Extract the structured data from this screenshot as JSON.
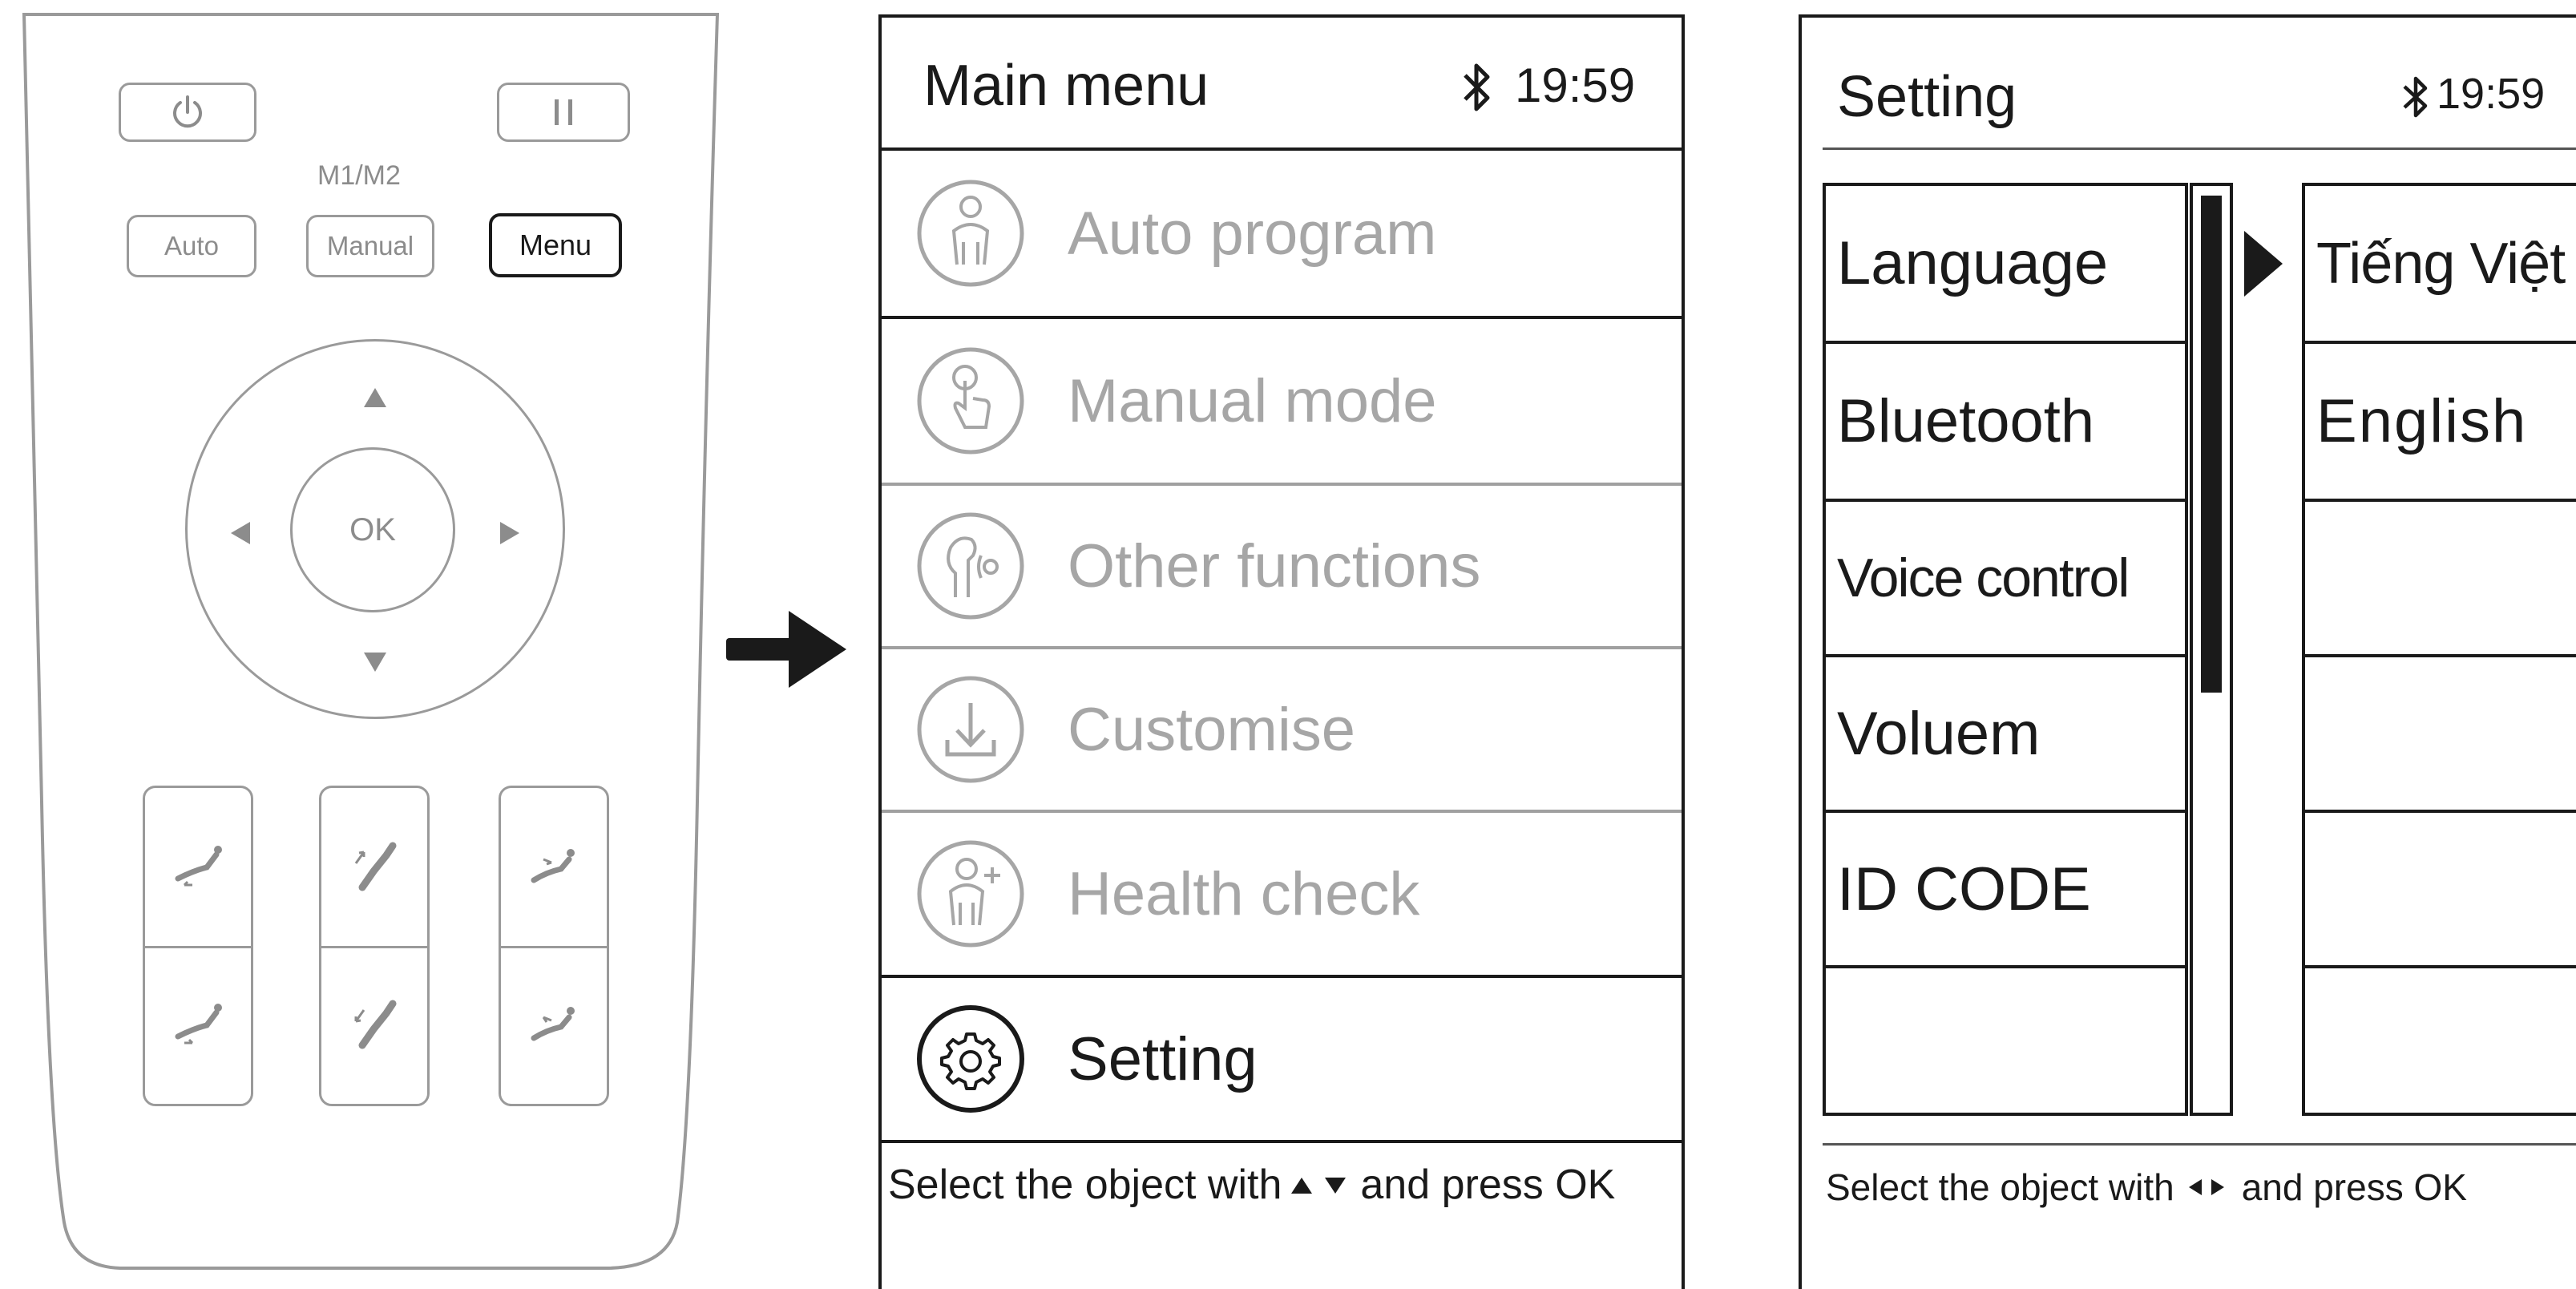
{
  "remote": {
    "power_icon": "power-icon",
    "pause_icon": "pause-icon",
    "m1m2_label": "M1/M2",
    "auto_label": "Auto",
    "manual_label": "Manual",
    "menu_label": "Menu",
    "ok_label": "OK"
  },
  "main_menu": {
    "title": "Main menu",
    "time": "19:59",
    "items": [
      {
        "label": "Auto program",
        "icon": "person-icon"
      },
      {
        "label": "Manual mode",
        "icon": "hand-touch-icon"
      },
      {
        "label": "Other functions",
        "icon": "head-wave-icon"
      },
      {
        "label": "Customise",
        "icon": "download-icon"
      },
      {
        "label": "Health check",
        "icon": "person-plus-icon"
      },
      {
        "label": "Setting",
        "icon": "gear-icon",
        "active": true
      }
    ],
    "footer_prefix": "Select the object with",
    "footer_suffix": "and press OK"
  },
  "settings": {
    "title": "Setting",
    "time": "19:59",
    "items": [
      "Language",
      "Bluetooth",
      "Voice control",
      "Voluem",
      "ID CODE",
      ""
    ],
    "options": [
      "Tiếng Việt",
      "English",
      "",
      "",
      "",
      ""
    ],
    "footer_prefix": "Select the object with",
    "footer_suffix": "and press OK"
  },
  "colors": {
    "ink": "#1a1a1a",
    "inactive": "#a6a6a6",
    "remote_outline": "#9a9a9a"
  }
}
